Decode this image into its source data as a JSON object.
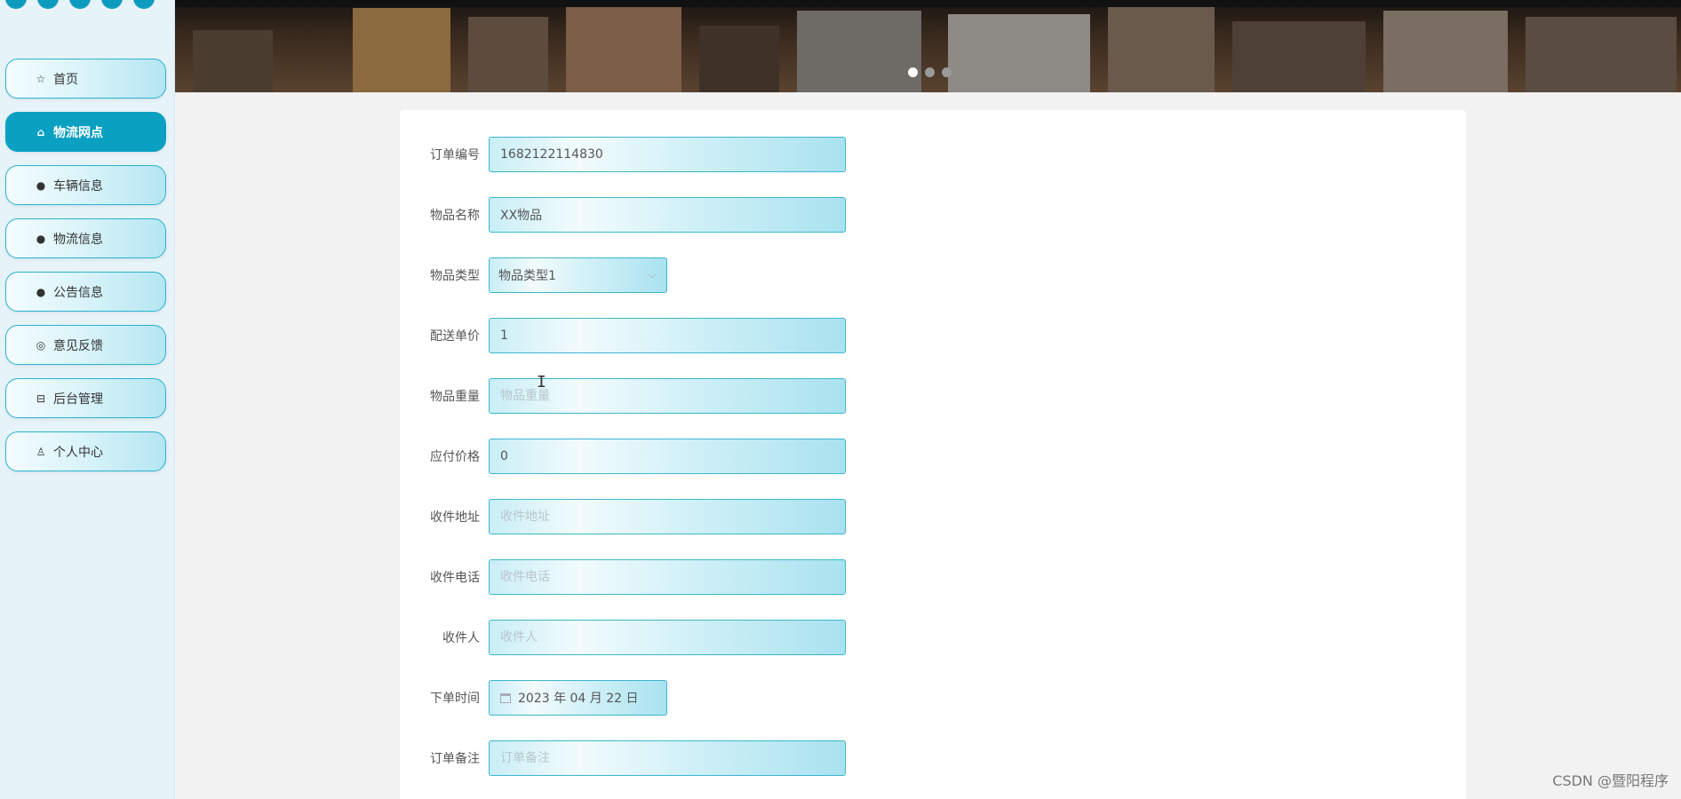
{
  "sidebar": {
    "items": [
      {
        "label": "首页",
        "icon": "☆"
      },
      {
        "label": "物流网点",
        "icon": "⌂"
      },
      {
        "label": "车辆信息",
        "icon": "●"
      },
      {
        "label": "物流信息",
        "icon": "●"
      },
      {
        "label": "公告信息",
        "icon": "●"
      },
      {
        "label": "意见反馈",
        "icon": "◎"
      },
      {
        "label": "后台管理",
        "icon": "⊟"
      },
      {
        "label": "个人中心",
        "icon": "♙"
      }
    ]
  },
  "form": {
    "order_no": {
      "label": "订单编号",
      "value": "1682122114830"
    },
    "item_name": {
      "label": "物品名称",
      "value": "XX物品"
    },
    "item_type": {
      "label": "物品类型",
      "value": "物品类型1"
    },
    "unit_price": {
      "label": "配送单价",
      "value": "1"
    },
    "weight": {
      "label": "物品重量",
      "placeholder": "物品重量"
    },
    "payable": {
      "label": "应付价格",
      "value": "0"
    },
    "address": {
      "label": "收件地址",
      "placeholder": "收件地址"
    },
    "phone": {
      "label": "收件电话",
      "placeholder": "收件电话"
    },
    "recipient": {
      "label": "收件人",
      "placeholder": "收件人"
    },
    "order_time": {
      "label": "下单时间",
      "value": "2023 年 04 月 22 日"
    },
    "remark": {
      "label": "订单备注",
      "placeholder": "订单备注"
    }
  },
  "watermark": "CSDN @暨阳程序",
  "colors": {
    "accent": "#0aa0c2",
    "border": "#3cb6cf"
  }
}
